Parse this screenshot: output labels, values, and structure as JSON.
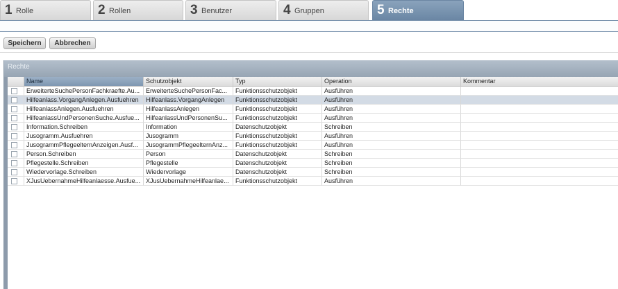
{
  "steps": [
    {
      "num": "1",
      "label": "Rolle"
    },
    {
      "num": "2",
      "label": "Rollen"
    },
    {
      "num": "3",
      "label": "Benutzer"
    },
    {
      "num": "4",
      "label": "Gruppen"
    },
    {
      "num": "5",
      "label": "Rechte"
    }
  ],
  "active_step": 5,
  "toolbar": {
    "save_label": "Speichern",
    "cancel_label": "Abbrechen"
  },
  "panel": {
    "title": "Rechte"
  },
  "table": {
    "columns": [
      "Name",
      "Schutzobjekt",
      "Typ",
      "Operation",
      "Kommentar"
    ],
    "sorted_column": "Name",
    "selected_row": 2,
    "rows": [
      {
        "name": "ErweiterteSuchePersonFachkraefte.Au...",
        "schutzobjekt": "ErweiterteSuchePersonFac...",
        "typ": "Funktionsschutzobjekt",
        "operation": "Ausführen",
        "kommentar": ""
      },
      {
        "name": "Hilfeanlass.VorgangAnlegen.Ausfuehren",
        "schutzobjekt": "Hilfeanlass.VorgangAnlegen",
        "typ": "Funktionsschutzobjekt",
        "operation": "Ausführen",
        "kommentar": ""
      },
      {
        "name": "HilfeanlassAnlegen.Ausfuehren",
        "schutzobjekt": "HilfeanlassAnlegen",
        "typ": "Funktionsschutzobjekt",
        "operation": "Ausführen",
        "kommentar": ""
      },
      {
        "name": "HilfeanlassUndPersonenSuche.Ausfue...",
        "schutzobjekt": "HilfeanlassUndPersonenSu...",
        "typ": "Funktionsschutzobjekt",
        "operation": "Ausführen",
        "kommentar": ""
      },
      {
        "name": "Information.Schreiben",
        "schutzobjekt": "Information",
        "typ": "Datenschutzobjekt",
        "operation": "Schreiben",
        "kommentar": ""
      },
      {
        "name": "Jusogramm.Ausfuehren",
        "schutzobjekt": "Jusogramm",
        "typ": "Funktionsschutzobjekt",
        "operation": "Ausführen",
        "kommentar": ""
      },
      {
        "name": "JusogrammPflegeelternAnzeigen.Ausf...",
        "schutzobjekt": "JusogrammPflegeelternAnz...",
        "typ": "Funktionsschutzobjekt",
        "operation": "Ausführen",
        "kommentar": ""
      },
      {
        "name": "Person.Schreiben",
        "schutzobjekt": "Person",
        "typ": "Datenschutzobjekt",
        "operation": "Schreiben",
        "kommentar": ""
      },
      {
        "name": "Pflegestelle.Schreiben",
        "schutzobjekt": "Pflegestelle",
        "typ": "Datenschutzobjekt",
        "operation": "Schreiben",
        "kommentar": ""
      },
      {
        "name": "Wiedervorlage.Schreiben",
        "schutzobjekt": "Wiedervorlage",
        "typ": "Datenschutzobjekt",
        "operation": "Schreiben",
        "kommentar": ""
      },
      {
        "name": "XJusUebernahmeHilfeanlaesse.Ausfue...",
        "schutzobjekt": "XJusUebernahmeHilfeanlae...",
        "typ": "Funktionsschutzobjekt",
        "operation": "Ausführen",
        "kommentar": ""
      }
    ]
  },
  "colors": {
    "active_tab": "#7891ac",
    "panel_header": "#a5b2c0",
    "selected_row": "#d3dbe5"
  }
}
